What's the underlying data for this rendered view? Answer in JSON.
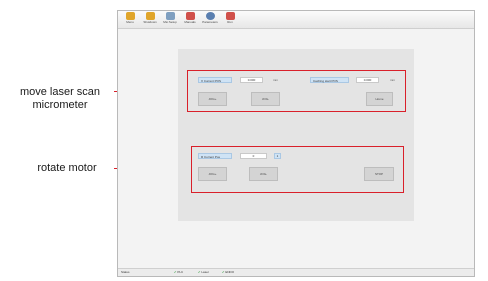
{
  "callouts": {
    "laser": "move laser scan\nmicrometer",
    "motor": "rotate motor"
  },
  "toolbar": {
    "items": [
      {
        "label": "Menu",
        "icon": "folder-icon",
        "color": "#e0a52a"
      },
      {
        "label": "Shutdown",
        "icon": "shutdown-icon",
        "color": "#e0a52a"
      },
      {
        "label": "Msr.Setup",
        "icon": "columns-icon",
        "color": "#7f9fc0"
      },
      {
        "label": "Manuals",
        "icon": "manual-icon",
        "color": "#d0504a"
      },
      {
        "label": "Parameters",
        "icon": "gear-icon",
        "color": "#5a7fb0"
      },
      {
        "label": "Run",
        "icon": "run-icon",
        "color": "#d0504a"
      }
    ]
  },
  "laser": {
    "current_label": "X Current POS",
    "current_value": "0.000",
    "current_unit": "mm",
    "target_label": "Caching start POS",
    "target_value": "0.000",
    "target_unit": "mm",
    "jog_plus": "JOG+",
    "jog_minus": "JOG-",
    "home": "Home"
  },
  "motor": {
    "current_label": "R Current Pos",
    "current_value": "0",
    "spin": "1",
    "jog_plus": "JOG+",
    "jog_minus": "JOG-",
    "stop": "STOP"
  },
  "status": {
    "left": "Status",
    "items": [
      "PLC",
      "Laser",
      "ENDO"
    ]
  },
  "colors": {
    "annotation": "#d9202a",
    "accent": "#cfe3f5"
  }
}
